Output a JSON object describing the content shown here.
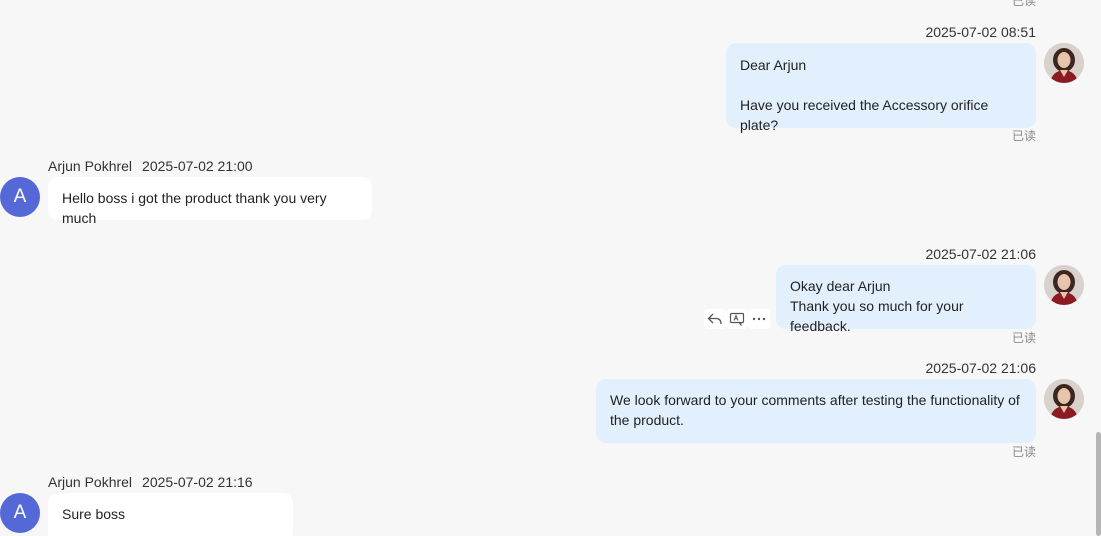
{
  "read_label": "已读",
  "messages": [
    {
      "timestamp": "2025-07-02 08:51",
      "line1": "Dear Arjun",
      "line2": "Have you received the Accessory orifice plate?"
    },
    {
      "sender": "Arjun Pokhrel",
      "timestamp": "2025-07-02 21:00",
      "avatar_letter": "A",
      "text": "Hello boss i got the product thank you very much"
    },
    {
      "timestamp": "2025-07-02 21:06",
      "line1": "Okay dear Arjun",
      "line2": "Thank you so much for your feedback."
    },
    {
      "timestamp": "2025-07-02 21:06",
      "line1": "We look forward to your comments after testing the functionality of",
      "line2": "the product."
    },
    {
      "sender": "Arjun Pokhrel",
      "timestamp": "2025-07-02 21:16",
      "avatar_letter": "A",
      "text": "Sure boss"
    }
  ],
  "colors": {
    "outgoing_bubble": "#e2effd",
    "incoming_bubble": "#ffffff",
    "contact_avatar": "#5468d8",
    "background": "#f7f7f7"
  },
  "icons": [
    "reply-icon",
    "translate-icon",
    "more-icon"
  ]
}
